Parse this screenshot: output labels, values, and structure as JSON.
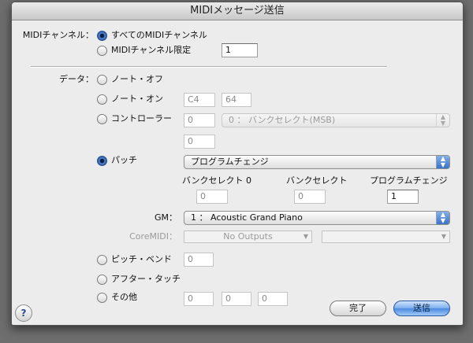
{
  "window": {
    "title": "MIDIメッセージ送信"
  },
  "channel": {
    "label": "MIDIチャンネル：",
    "opt_all": "すべてのMIDIチャンネル",
    "opt_specific": "MIDIチャンネル限定",
    "specific_value": "1"
  },
  "data_label": "データ：",
  "note_off": {
    "label": "ノート・オフ"
  },
  "note_on": {
    "label": "ノート・オン",
    "note": "C4",
    "velocity": "64"
  },
  "controller": {
    "label": "コントローラー",
    "value1": "0",
    "selected": "0 ： バンクセレクト(MSB)",
    "value2": "0"
  },
  "patch": {
    "label": "パッチ",
    "type_selected": "プログラムチェンジ",
    "bank0_label": "バンクセレクト 0",
    "bank0_value": "0",
    "bank_label": "バンクセレクト",
    "bank_value": "0",
    "program_label": "プログラムチェンジ",
    "program_value": "1"
  },
  "gm": {
    "label": "GM：",
    "selected": "1 ： Acoustic Grand Piano"
  },
  "coremidi": {
    "label": "CoreMIDI：",
    "selected": "No Outputs",
    "second": ""
  },
  "pitch_bend": {
    "label": "ピッチ・ベンド",
    "value": "0"
  },
  "aftertouch": {
    "label": "アフター・タッチ"
  },
  "other": {
    "label": "その他",
    "v1": "0",
    "v2": "0",
    "v3": "0"
  },
  "buttons": {
    "done": "完了",
    "send": "送信",
    "help": "?"
  },
  "icons": {
    "popup_arrows": "▲▼",
    "dropdown": "▼"
  }
}
